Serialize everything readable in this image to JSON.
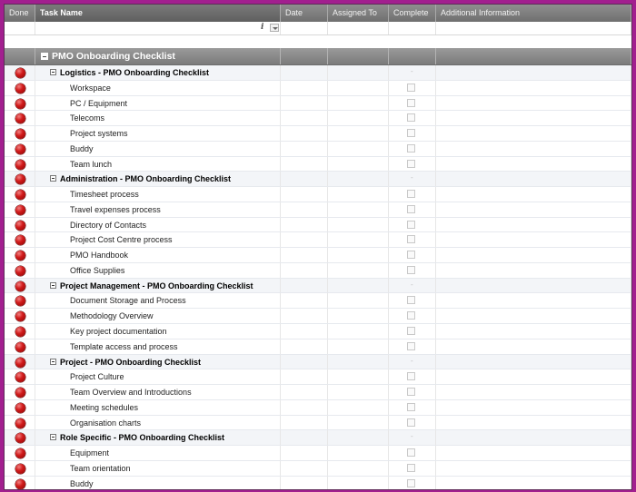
{
  "columns": {
    "done": "Done",
    "task_name": "Task Name",
    "date": "Date",
    "assigned_to": "Assigned To",
    "complete": "Complete",
    "additional_information": "Additional Information"
  },
  "filter_row": {
    "info_glyph": "i",
    "filter_icon": "dropdown-arrow-icon"
  },
  "root": {
    "label": "PMO Onboarding Checklist"
  },
  "groups": [
    {
      "label": "Logistics - PMO Onboarding Checklist",
      "tasks": [
        "Workspace",
        "PC / Equipment",
        "Telecoms",
        "Project systems",
        "Buddy",
        "Team lunch"
      ]
    },
    {
      "label": "Administration - PMO Onboarding Checklist",
      "tasks": [
        "Timesheet process",
        "Travel expenses process",
        "Directory of Contacts",
        "Project Cost Centre process",
        "PMO Handbook",
        "Office Supplies"
      ]
    },
    {
      "label": "Project Management - PMO Onboarding Checklist",
      "tasks": [
        "Document Storage and Process",
        "Methodology Overview",
        "Key project documentation",
        "Template access and process"
      ]
    },
    {
      "label": "Project - PMO Onboarding Checklist",
      "tasks": [
        "Project Culture",
        "Team Overview and Introductions",
        "Meeting schedules",
        "Organisation charts"
      ]
    },
    {
      "label": "Role Specific - PMO Onboarding Checklist",
      "tasks": [
        "Equipment",
        "Team orientation",
        "Buddy"
      ]
    }
  ],
  "colors": {
    "frame": "#a21f8f",
    "header": "#7a7a7a",
    "status_dot": "#d21c1c"
  }
}
